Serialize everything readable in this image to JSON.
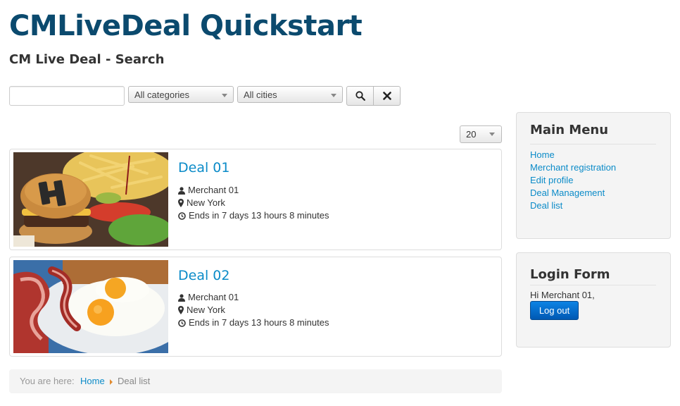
{
  "site": {
    "title": "CMLiveDeal Quickstart"
  },
  "page": {
    "heading": "CM Live Deal - Search"
  },
  "search": {
    "keyword_value": "",
    "category_selected": "All categories",
    "city_selected": "All cities",
    "search_icon": "search-icon",
    "clear_icon": "close-icon"
  },
  "list": {
    "limit_selected": "20"
  },
  "deals": [
    {
      "title": "Deal 01",
      "merchant": "Merchant 01",
      "city": "New York",
      "ends": "Ends in 7 days 13 hours 8 minutes",
      "image": "burger-and-fries"
    },
    {
      "title": "Deal 02",
      "merchant": "Merchant 01",
      "city": "New York",
      "ends": "Ends in 7 days 13 hours 8 minutes",
      "image": "bacon-and-eggs"
    }
  ],
  "main_menu": {
    "title": "Main Menu",
    "items": [
      "Home",
      "Merchant registration",
      "Edit profile",
      "Deal Management",
      "Deal list"
    ]
  },
  "login_form": {
    "title": "Login Form",
    "greeting": "Hi Merchant 01,",
    "logout_label": "Log out"
  },
  "breadcrumb": {
    "label": "You are here:",
    "home": "Home",
    "current": "Deal list"
  },
  "colors": {
    "title": "#0b4a6e",
    "link": "#0b8bc8",
    "primary_button": "#0a6fd1",
    "breadcrumb_divider": "#e08a2e"
  }
}
